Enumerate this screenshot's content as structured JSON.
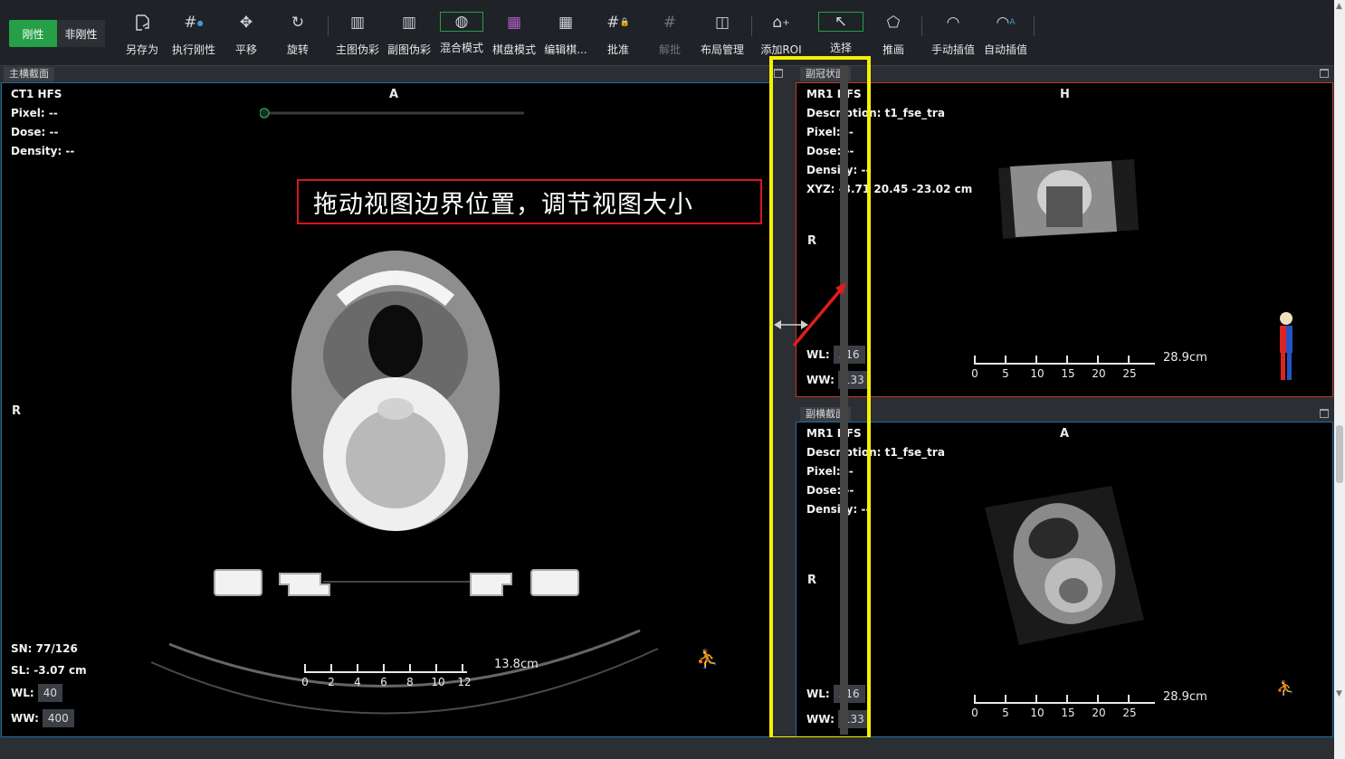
{
  "toolbar": {
    "rigid_label": "刚性",
    "nonrigid_label": "非刚性",
    "tools": [
      {
        "label": "另存为",
        "icon": "save-as-icon"
      },
      {
        "label": "执行刚性",
        "icon": "execute-rigid-icon"
      },
      {
        "label": "平移",
        "icon": "pan-icon"
      },
      {
        "label": "旋转",
        "icon": "rotate-icon"
      },
      {
        "label": "主图伪彩",
        "icon": "primary-pseudocolor-icon"
      },
      {
        "label": "副图伪彩",
        "icon": "secondary-pseudocolor-icon"
      },
      {
        "label": "混合模式",
        "icon": "blend-mode-icon"
      },
      {
        "label": "棋盘模式",
        "icon": "checkerboard-icon"
      },
      {
        "label": "编辑棋...",
        "icon": "edit-checkerboard-icon"
      },
      {
        "label": "批准",
        "icon": "approve-icon"
      },
      {
        "label": "解批",
        "icon": "unapprove-icon"
      },
      {
        "label": "布局管理",
        "icon": "layout-icon"
      },
      {
        "label": "添加ROI",
        "icon": "add-roi-icon"
      },
      {
        "label": "选择",
        "icon": "select-icon"
      },
      {
        "label": "推画",
        "icon": "push-draw-icon"
      },
      {
        "label": "手动插值",
        "icon": "manual-interp-icon"
      },
      {
        "label": "自动插值",
        "icon": "auto-interp-icon"
      }
    ]
  },
  "main_view": {
    "tab": "主横截面",
    "title": "CT1 HFS",
    "pixel": "Pixel: --",
    "dose": "Dose: --",
    "density": "Density: --",
    "top_dir": "A",
    "left_dir": "R",
    "sn": "SN: 77/126",
    "sl": "SL: -3.07 cm",
    "wl_label": "WL:",
    "wl": "40",
    "ww_label": "WW:",
    "ww": "400",
    "ruler_ticks": [
      "0",
      "2",
      "4",
      "6",
      "8",
      "10",
      "12"
    ],
    "ruler_len": "13.8cm"
  },
  "coronal_view": {
    "tab": "副冠状面",
    "title": "MR1 HFS",
    "description": "Description: t1_fse_tra",
    "pixel": "Pixel: --",
    "dose": "Dose: --",
    "density": "Density: --",
    "xyz": "XYZ: -3.71 20.45 -23.02 cm",
    "top_dir": "H",
    "left_dir": "R",
    "wl_label": "WL:",
    "wl": "516",
    "ww_label": "WW:",
    "ww": "133",
    "ruler_ticks": [
      "0",
      "5",
      "10",
      "15",
      "20",
      "25"
    ],
    "ruler_len": "28.9cm"
  },
  "axial_view": {
    "tab": "副横截面",
    "title": "MR1 HFS",
    "description": "Description: t1_fse_tra",
    "pixel": "Pixel: --",
    "dose": "Dose: --",
    "density": "Density: --",
    "top_dir": "A",
    "left_dir": "R",
    "wl_label": "WL:",
    "wl": "516",
    "ww_label": "WW:",
    "ww": "133",
    "ruler_ticks": [
      "0",
      "5",
      "10",
      "15",
      "20",
      "25"
    ],
    "ruler_len": "28.9cm"
  },
  "callout_text": "拖动视图边界位置，调节视图大小",
  "colors": {
    "accent": "#25a046",
    "highlight": "#f5f000",
    "callout_border": "#d8141c",
    "active_view_border": "#c0392b",
    "view_border": "#1d6fa3"
  }
}
